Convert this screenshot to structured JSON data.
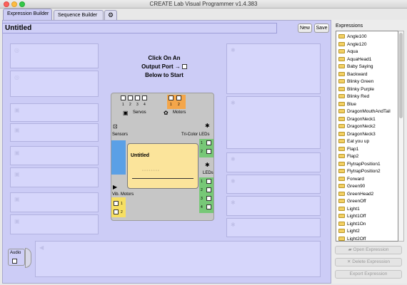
{
  "window": {
    "title": "CREATE Lab Visual Programmer v1.4.383"
  },
  "tabs": [
    {
      "label": "Expression Builder",
      "active": true
    },
    {
      "label": "Sequence Builder",
      "active": false
    },
    {
      "label": "⚙",
      "icon": "gear-icon"
    }
  ],
  "expression": {
    "title": "Untitled"
  },
  "toolbar": {
    "new_label": "New",
    "save_label": "Save"
  },
  "instructions": {
    "line1": "Click On An",
    "line2": "Output Port →",
    "line3": "Below to Start"
  },
  "board": {
    "servo_ports": [
      "1",
      "2",
      "3",
      "4"
    ],
    "servos_label": "Servos",
    "motor_ports": [
      "1",
      "2"
    ],
    "motors_label": "Motors",
    "sensors_label": "Sensors",
    "tricolor_label": "Tri-Color LEDs",
    "tricolor_ports": [
      "1",
      "2"
    ],
    "leds_label": "LEDs",
    "led_ports": [
      "1",
      "2",
      "3",
      "4"
    ],
    "vib_label": "Vib. Motors",
    "vib_ports": [
      "1",
      "2"
    ],
    "card_title": "Untitled"
  },
  "audio": {
    "label": "Audio"
  },
  "expressions_panel": {
    "label": "Expressions",
    "items": [
      "Angle100",
      "Angle120",
      "Aqua",
      "AquaHead1",
      "Baby Saying",
      "Backward",
      "Blinky Green",
      "Blinky Purple",
      "Blinky Red",
      "Blue",
      "DragonMouthAndTail",
      "DragonNeck1",
      "DragonNeck2",
      "DragonNeck3",
      "Eat you up",
      "Flap1",
      "Flap2",
      "FlytrapPosition1",
      "FlytrapPosition2",
      "Forward",
      "Green90",
      "GreenHead2",
      "GreenOff",
      "Light1",
      "Light1Off",
      "Light1On",
      "Light2",
      "Light2Off"
    ],
    "open_label": "Open Expression",
    "delete_label": "Delete Expression",
    "export_label": "Export Expression"
  },
  "colors": {
    "workspace": "#ccccf6",
    "motor_orange": "#f4a64a",
    "sensor_blue": "#5aa0e6",
    "led_green": "#77c877",
    "vib_yellow": "#f6df62",
    "card_yellow": "#fbe49b"
  }
}
